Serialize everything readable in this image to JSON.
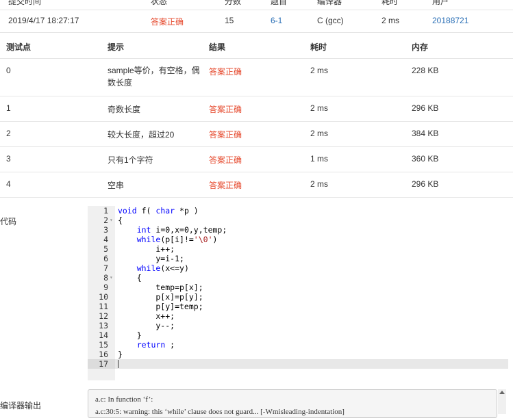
{
  "submission": {
    "headers": [
      "提交时间",
      "状态",
      "分数",
      "题目",
      "编译器",
      "耗时",
      "用户"
    ],
    "time": "2019/4/17 18:27:17",
    "status": "答案正确",
    "score": "15",
    "problem": "6-1",
    "compiler": "C (gcc)",
    "duration": "2 ms",
    "user": "20188721"
  },
  "tests": {
    "headers": [
      "测试点",
      "提示",
      "结果",
      "耗时",
      "内存"
    ],
    "rows": [
      {
        "id": "0",
        "hint": "sample等价，有空格，偶数长度",
        "result": "答案正确",
        "time": "2 ms",
        "mem": "228 KB"
      },
      {
        "id": "1",
        "hint": "奇数长度",
        "result": "答案正确",
        "time": "2 ms",
        "mem": "296 KB"
      },
      {
        "id": "2",
        "hint": "较大长度，超过20",
        "result": "答案正确",
        "time": "2 ms",
        "mem": "384 KB"
      },
      {
        "id": "3",
        "hint": "只有1个字符",
        "result": "答案正确",
        "time": "1 ms",
        "mem": "360 KB"
      },
      {
        "id": "4",
        "hint": "空串",
        "result": "答案正确",
        "time": "2 ms",
        "mem": "296 KB"
      }
    ]
  },
  "code": {
    "label": "代码",
    "lines": [
      "void f( char *p )",
      "{",
      "    int i=0,x=0,y,temp;",
      "    while(p[i]!='\\0')",
      "        i++;",
      "        y=i-1;",
      "    while(x<=y)",
      "    {",
      "        temp=p[x];",
      "        p[x]=p[y];",
      "        p[y]=temp;",
      "        x++;",
      "        y--;",
      "    }",
      "    return ;",
      "}",
      ""
    ],
    "fold_lines": [
      2,
      8
    ]
  },
  "compiler_output": {
    "label": "编译器输出",
    "lines": [
      "a.c: In function ‘f’:",
      "a.c:30:5: warning: this ‘while’ clause does not guard... [-Wmisleading-indentation]"
    ]
  }
}
